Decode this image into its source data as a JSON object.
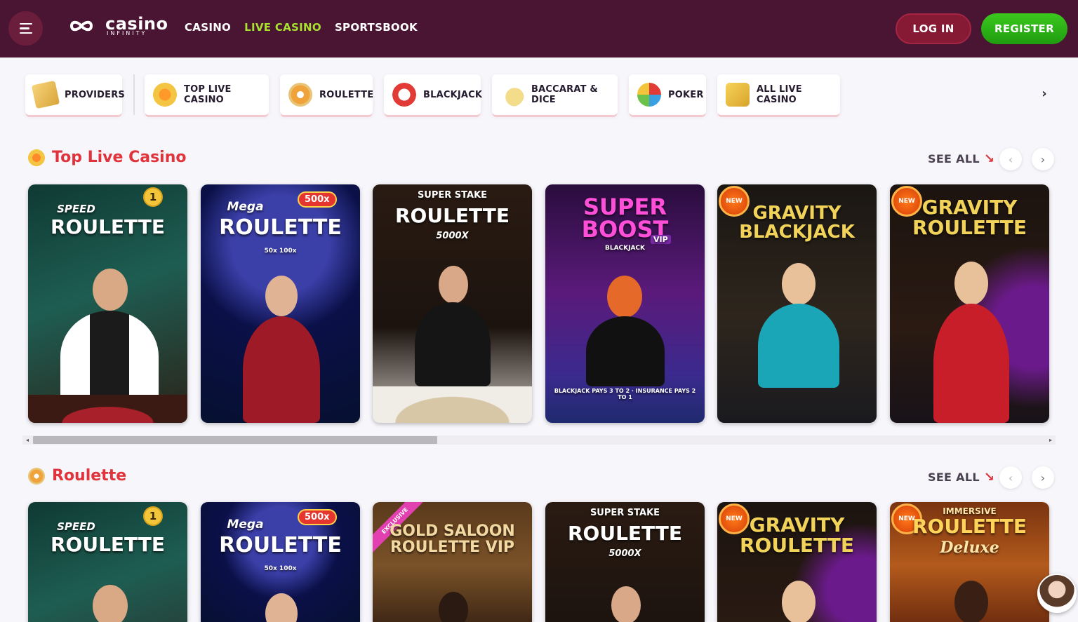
{
  "header": {
    "logo_text": "casino",
    "logo_subtext": "INFINITY",
    "nav": [
      "CASINO",
      "LIVE CASINO",
      "SPORTSBOOK"
    ],
    "active_nav": "LIVE CASINO",
    "login_label": "LOG IN",
    "register_label": "REGISTER"
  },
  "categories": [
    {
      "label": "PROVIDERS",
      "icon": "providers-icon"
    },
    {
      "label": "TOP LIVE CASINO",
      "icon": "crown-icon"
    },
    {
      "label": "ROULETTE",
      "icon": "roulette-wheel-icon"
    },
    {
      "label": "BLACKJACK",
      "icon": "blackjack-chip-icon"
    },
    {
      "label": "BACCARAT & DICE",
      "icon": "baccarat-icon"
    },
    {
      "label": "POKER",
      "icon": "poker-chip-icon"
    },
    {
      "label": "ALL LIVE CASINO",
      "icon": "dice-icon"
    }
  ],
  "sections": [
    {
      "title": "Top Live Casino",
      "icon": "crown-icon",
      "see_all": "SEE ALL",
      "games": [
        {
          "top": "SPEED",
          "name": "ROULETTE",
          "badge": "1",
          "theme": "speed"
        },
        {
          "top": "Mega",
          "name": "ROULETTE",
          "badge": "500x",
          "sub": "50x 100x",
          "theme": "mega"
        },
        {
          "top": "SUPER STAKE",
          "name": "ROULETTE",
          "sub": "5000X",
          "theme": "stake"
        },
        {
          "top": "",
          "name": "SUPER BOOST",
          "sub": "BLACKJACK",
          "tag": "VIP",
          "bottom": "BLACKJACK PAYS 3 TO 2 · INSURANCE PAYS 2 TO 1",
          "theme": "boost"
        },
        {
          "top": "",
          "name": "GRAVITY BLACKJACK",
          "new": "NEW",
          "theme": "gbj"
        },
        {
          "top": "",
          "name": "GRAVITY ROULETTE",
          "new": "NEW",
          "theme": "groul"
        }
      ]
    },
    {
      "title": "Roulette",
      "icon": "roulette-wheel-icon",
      "see_all": "SEE ALL",
      "games": [
        {
          "top": "SPEED",
          "name": "ROULETTE",
          "badge": "1",
          "theme": "speed"
        },
        {
          "top": "Mega",
          "name": "ROULETTE",
          "badge": "500x",
          "sub": "50x 100x",
          "theme": "mega"
        },
        {
          "top": "",
          "name": "GOLD SALOON ROULETTE VIP",
          "exclusive": "EXCLUSIVE",
          "theme": "saloon"
        },
        {
          "top": "SUPER STAKE",
          "name": "ROULETTE",
          "sub": "5000X",
          "theme": "stake"
        },
        {
          "top": "",
          "name": "GRAVITY ROULETTE",
          "new": "NEW",
          "theme": "groul"
        },
        {
          "top": "IMMERSIVE",
          "name": "ROULETTE",
          "sub": "Deluxe",
          "new": "NEW",
          "theme": "immersive"
        }
      ]
    }
  ],
  "colors": {
    "header_bg": "#4a1532",
    "active_nav": "#a6e22e",
    "section_title": "#e0333b",
    "register": "#2bb517",
    "login": "#861a35"
  }
}
